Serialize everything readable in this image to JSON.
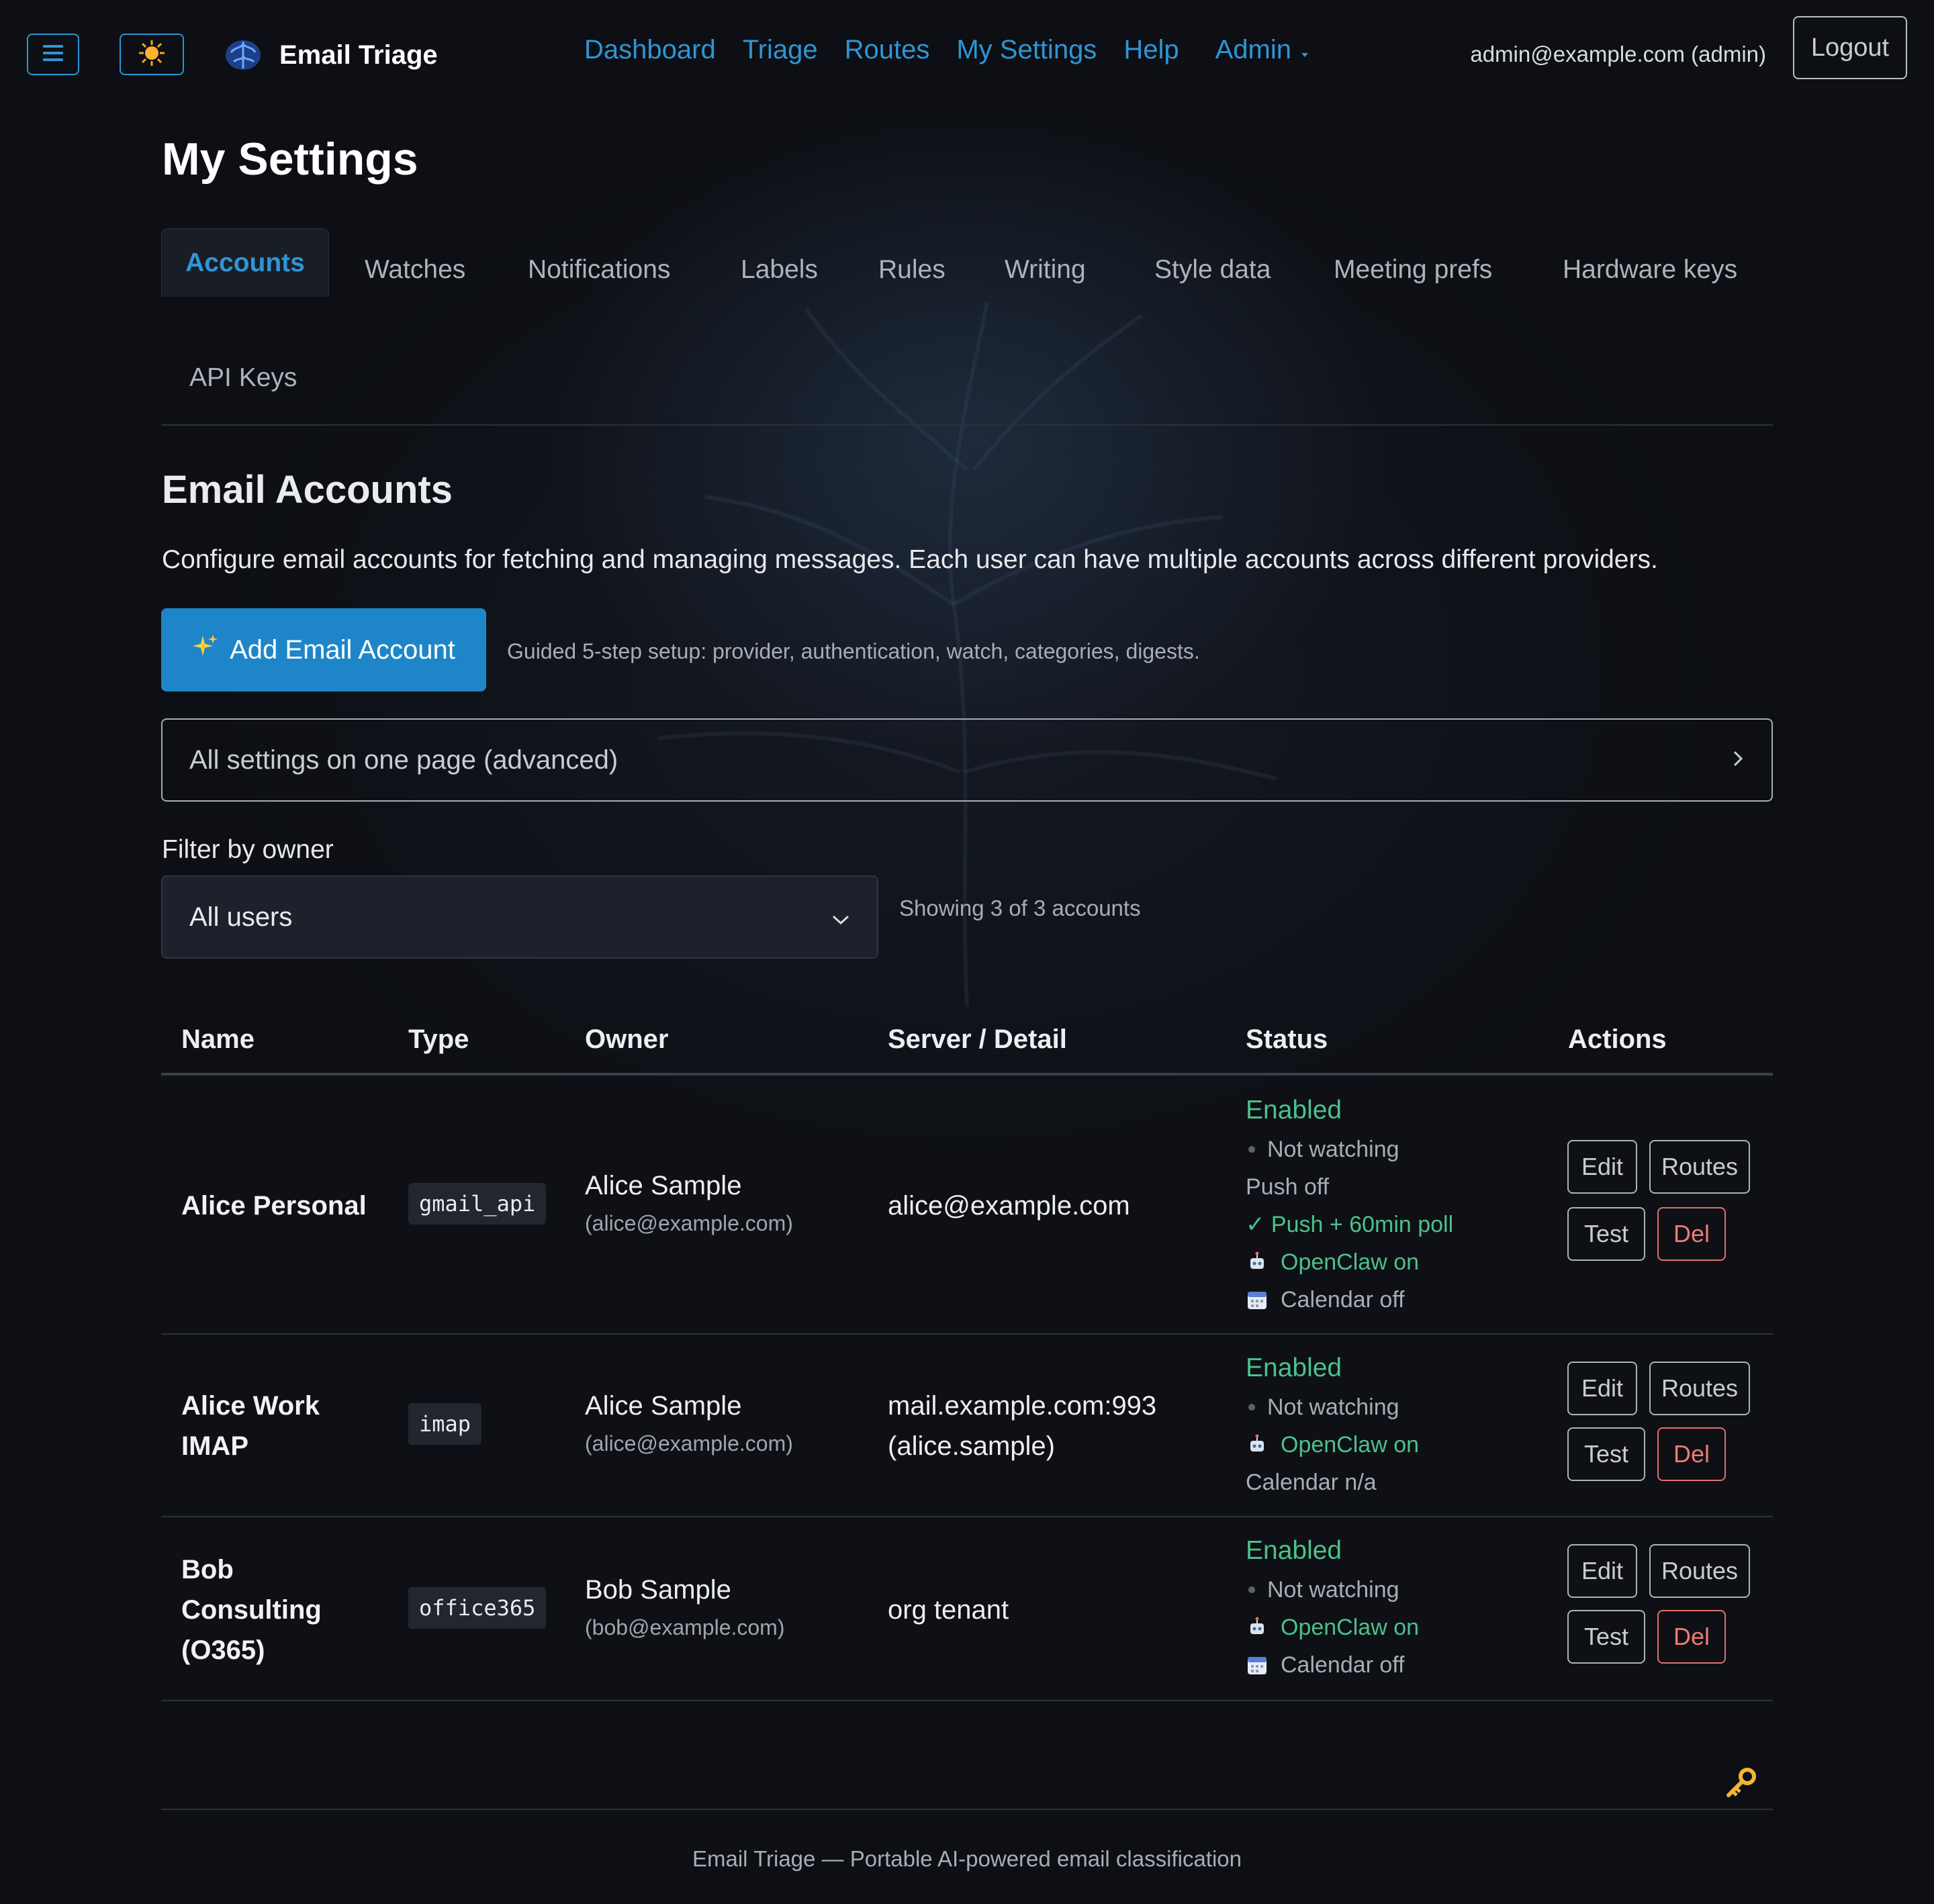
{
  "brand": {
    "title": "Email Triage"
  },
  "nav": {
    "links": [
      "Dashboard",
      "Triage",
      "Routes",
      "My Settings",
      "Help"
    ],
    "admin_label": "Admin",
    "user_email": "admin@example.com (admin)",
    "logout_label": "Logout"
  },
  "page": {
    "title": "My Settings"
  },
  "tabs": [
    {
      "label": "Accounts",
      "active": true
    },
    {
      "label": "Watches"
    },
    {
      "label": "Notifications"
    },
    {
      "label": "Labels"
    },
    {
      "label": "Rules"
    },
    {
      "label": "Writing"
    },
    {
      "label": "Style data"
    },
    {
      "label": "Meeting prefs"
    },
    {
      "label": "Hardware keys"
    },
    {
      "label": "API Keys"
    }
  ],
  "section": {
    "title": "Email Accounts",
    "intro": "Configure email accounts for fetching and managing messages. Each user can have multiple accounts across different providers.",
    "add_button": "Add Email Account",
    "add_hint": "Guided 5-step setup: provider, authentication, watch, categories, digests.",
    "advanced_label": "All settings on one page (advanced)",
    "filter_label": "Filter by owner",
    "filter_value": "All users",
    "showing": "Showing 3 of 3 accounts"
  },
  "table": {
    "headers": [
      "Name",
      "Type",
      "Owner",
      "Server / Detail",
      "Status",
      "Actions"
    ],
    "rows": [
      {
        "name_lines": [
          "Alice Personal"
        ],
        "type": "gmail_api",
        "owner_name": "Alice Sample",
        "owner_email": "(alice@example.com)",
        "detail_lines": [
          "alice@example.com"
        ],
        "status": {
          "enabled": "Enabled",
          "not_watching": "Not watching",
          "push": "Push off",
          "poll": "✓ Push + 60min poll",
          "openclaw": "OpenClaw on",
          "calendar": "Calendar off"
        }
      },
      {
        "name_lines": [
          "Alice Work",
          "IMAP"
        ],
        "type": "imap",
        "owner_name": "Alice Sample",
        "owner_email": "(alice@example.com)",
        "detail_lines": [
          "mail.example.com:993",
          "(alice.sample)"
        ],
        "status": {
          "enabled": "Enabled",
          "not_watching": "Not watching",
          "openclaw": "OpenClaw on",
          "calendar": "Calendar n/a"
        }
      },
      {
        "name_lines": [
          "Bob",
          "Consulting",
          "(O365)"
        ],
        "type": "office365",
        "owner_name": "Bob Sample",
        "owner_email": "(bob@example.com)",
        "detail_lines": [
          "org tenant"
        ],
        "status": {
          "enabled": "Enabled",
          "not_watching": "Not watching",
          "openclaw": "OpenClaw on",
          "calendar": "Calendar off"
        }
      }
    ],
    "actions": {
      "edit": "Edit",
      "routes": "Routes",
      "test": "Test",
      "del": "Del"
    }
  },
  "footer": {
    "text": "Email Triage — Portable AI-powered email classification"
  },
  "colors": {
    "accent": "#2f95d6",
    "primary_button": "#1e86c8",
    "success": "#4cc08c",
    "danger": "#ee7b74",
    "background": "#0d0f14"
  },
  "icons": [
    "menu-icon",
    "sun-icon",
    "brain-logo-icon",
    "chevron-right-icon",
    "chevron-down-icon",
    "sparkles-icon",
    "robot-icon",
    "calendar-icon",
    "key-icon"
  ]
}
